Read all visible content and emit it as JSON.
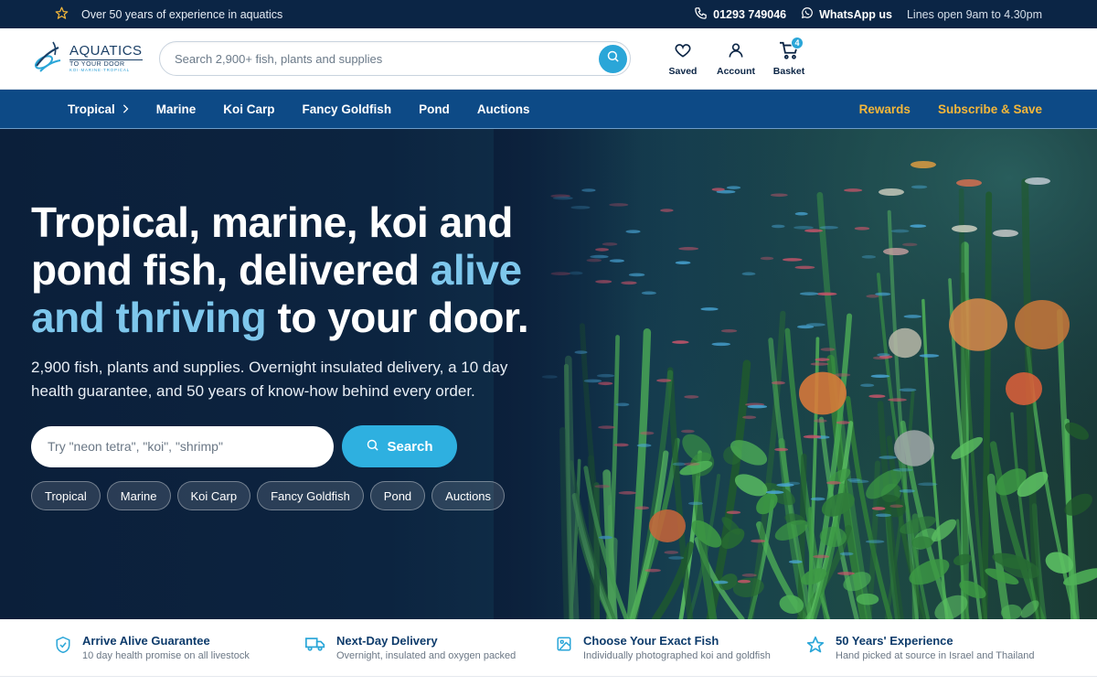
{
  "topbar": {
    "experience": "Over 50 years of experience in aquatics",
    "phone": "01293 749046",
    "whatsapp": "WhatsApp us",
    "hours": "Lines open 9am to 4.30pm"
  },
  "logo": {
    "line1": "AQUATICS",
    "line2": "TO YOUR DOOR",
    "line3": "KOI·MARINE·TROPICAL"
  },
  "header": {
    "search_placeholder": "Search 2,900+ fish, plants and supplies",
    "saved": "Saved",
    "account": "Account",
    "basket": "Basket",
    "basket_count": "4"
  },
  "nav": {
    "items": [
      "Tropical",
      "Marine",
      "Koi Carp",
      "Fancy Goldfish",
      "Pond",
      "Auctions"
    ],
    "rewards": "Rewards",
    "subscribe": "Subscribe & Save"
  },
  "hero": {
    "title_part1": "Tropical, marine, koi and pond fish, delivered",
    "title_accent": "alive and thriving",
    "title_part2": "to your door.",
    "subtitle": "2,900 fish, plants and supplies. Overnight insulated delivery, a 10 day health guarantee, and 50 years of know-how behind every order.",
    "search_placeholder": "Try \"neon tetra\", \"koi\", \"shrimp\"",
    "search_button": "Search",
    "chips": [
      "Tropical",
      "Marine",
      "Koi Carp",
      "Fancy Goldfish",
      "Pond",
      "Auctions"
    ]
  },
  "features": [
    {
      "title": "Arrive Alive Guarantee",
      "desc": "10 day health promise on all livestock",
      "icon": "shield-check-icon"
    },
    {
      "title": "Next-Day Delivery",
      "desc": "Overnight, insulated and oxygen packed",
      "icon": "truck-icon"
    },
    {
      "title": "Choose Your Exact Fish",
      "desc": "Individually photographed koi and goldfish",
      "icon": "image-icon"
    },
    {
      "title": "50 Years' Experience",
      "desc": "Hand picked at source in Israel and Thailand",
      "icon": "star-icon"
    }
  ],
  "colors": {
    "navy": "#0b2545",
    "nav_blue": "#0d4a86",
    "accent": "#2aa6d8",
    "gold": "#f4b73a",
    "hero_accent": "#7ec7ec"
  }
}
